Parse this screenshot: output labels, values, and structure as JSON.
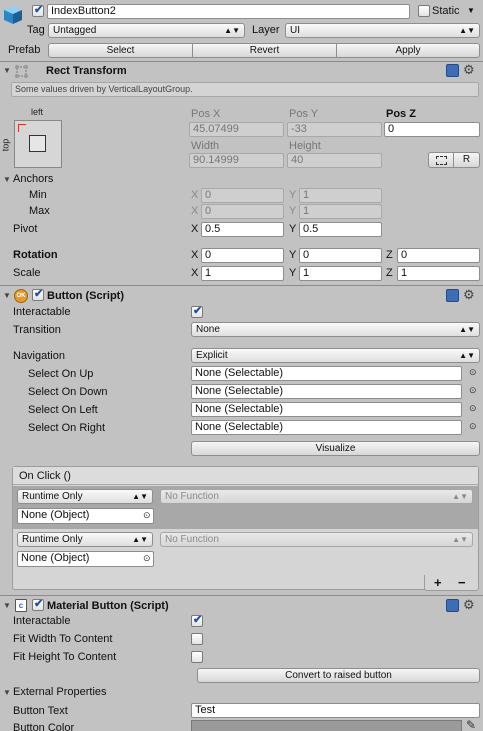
{
  "go": {
    "name": "IndexButton2",
    "static_label": "Static",
    "tag_label": "Tag",
    "tag_value": "Untagged",
    "layer_label": "Layer",
    "layer_value": "UI",
    "prefab_label": "Prefab",
    "select": "Select",
    "revert": "Revert",
    "apply": "Apply"
  },
  "rect": {
    "title": "Rect Transform",
    "notice": "Some values driven by VerticalLayoutGroup.",
    "anchor_left": "left",
    "anchor_top": "top",
    "posx_label": "Pos X",
    "posy_label": "Pos Y",
    "posz_label": "Pos Z",
    "posx": "45.07499",
    "posy": "-33",
    "posz": "0",
    "width_label": "Width",
    "height_label": "Height",
    "width": "90.14999",
    "height": "40",
    "blueprint_btn": "",
    "raw_btn": "R",
    "anchors_label": "Anchors",
    "min_label": "Min",
    "max_label": "Max",
    "min_x": "0",
    "min_y": "1",
    "max_x": "0",
    "max_y": "1",
    "pivot_label": "Pivot",
    "pivot_x": "0.5",
    "pivot_y": "0.5",
    "rotation_label": "Rotation",
    "rot_x": "0",
    "rot_y": "0",
    "rot_z": "0",
    "scale_label": "Scale",
    "scale_x": "1",
    "scale_y": "1",
    "scale_z": "1",
    "x": "X",
    "y": "Y",
    "z": "Z"
  },
  "button": {
    "title": "Button (Script)",
    "interactable_label": "Interactable",
    "transition_label": "Transition",
    "transition_value": "None",
    "navigation_label": "Navigation",
    "navigation_value": "Explicit",
    "up_label": "Select On Up",
    "down_label": "Select On Down",
    "left_label": "Select On Left",
    "right_label": "Select On Right",
    "up_value": "None (Selectable)",
    "down_value": "None (Selectable)",
    "left_value": "None (Selectable)",
    "right_value": "None (Selectable)",
    "visualize": "Visualize",
    "onclick_title": "On Click ()",
    "events": [
      {
        "runtime": "Runtime Only",
        "function": "No Function",
        "object": "None (Object)"
      },
      {
        "runtime": "Runtime Only",
        "function": "No Function",
        "object": "None (Object)"
      }
    ],
    "plus": "+",
    "minus": "−"
  },
  "material": {
    "title": "Material Button (Script)",
    "interactable_label": "Interactable",
    "fit_width_label": "Fit Width To Content",
    "fit_height_label": "Fit Height To Content",
    "convert": "Convert to raised button",
    "ext_label": "External Properties",
    "button_text_label": "Button Text",
    "button_text_value": "Test",
    "button_color_label": "Button Color"
  }
}
